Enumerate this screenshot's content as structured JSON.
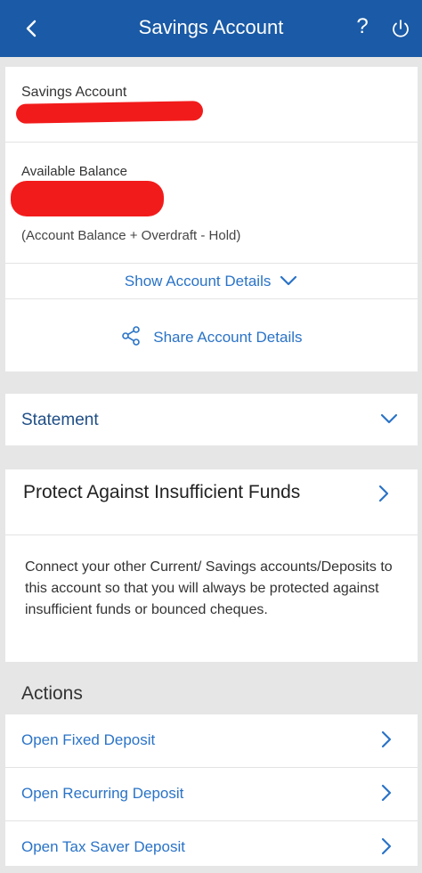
{
  "header": {
    "title": "Savings Account",
    "help_glyph": "?"
  },
  "account": {
    "type_label": "Savings Account",
    "available_balance_label": "Available Balance",
    "formula": "(Account Balance + Overdraft - Hold)",
    "show_details_label": "Show Account Details",
    "share_details_label": "Share Account Details"
  },
  "statement": {
    "label": "Statement"
  },
  "protect": {
    "title": "Protect Against Insufficient Funds",
    "body": "Connect your other Current/ Savings accounts/Deposits to this account so that you will always be protected against insufficient funds or bounced cheques."
  },
  "actions": {
    "heading": "Actions",
    "items": [
      {
        "label": "Open Fixed Deposit"
      },
      {
        "label": "Open Recurring Deposit"
      },
      {
        "label": "Open Tax Saver Deposit"
      }
    ]
  },
  "colors": {
    "header_bg": "#1a5aa6",
    "link": "#2a73c7",
    "redaction": "#f21b1b"
  }
}
